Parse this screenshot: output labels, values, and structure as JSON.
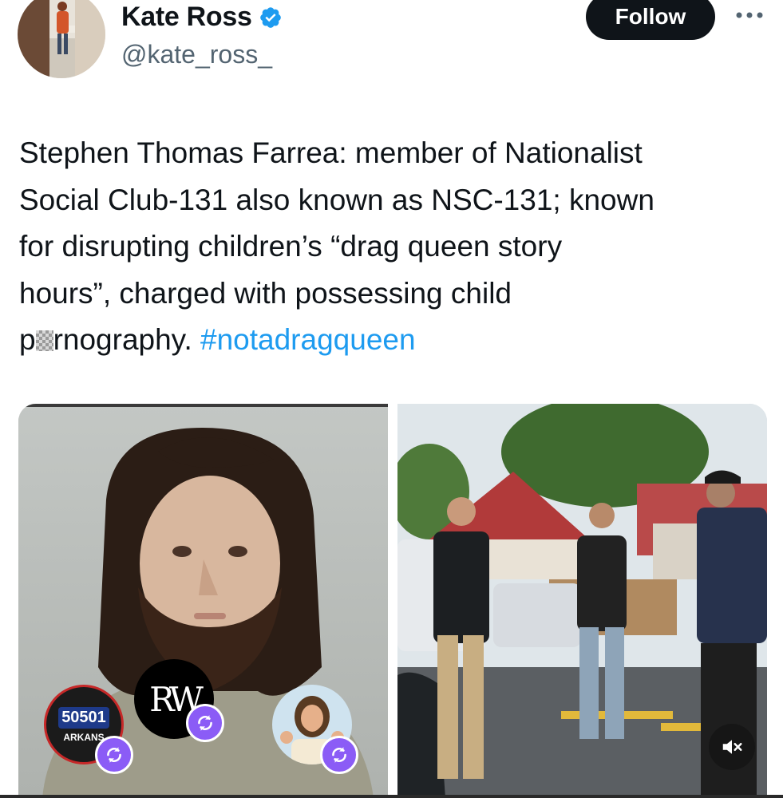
{
  "account": {
    "display_name": "Kate Ross",
    "handle": "@kate_ross_",
    "verified": true,
    "verified_color": "#1d9bf0"
  },
  "header": {
    "follow_label": "Follow",
    "more_icon": "more-dots-icon"
  },
  "tweet": {
    "text_line1": "Stephen Thomas Farrea: member of Nationalist",
    "text_line2": "Social Club-131 also known as NSC-131; known",
    "text_line3": "for disrupting children’s “drag queen story",
    "text_line4": "hours”, charged with possessing child",
    "text_word_prefix": "p",
    "text_word_suffix": "rnography.",
    "hashtag": "#notadragqueen",
    "hashtag_color": "#1d9bf0"
  },
  "media": {
    "stickers": [
      {
        "name": "50501-arkansas-sticker",
        "text_top": "50501",
        "text_bottom": "ARKANS"
      },
      {
        "name": "rw-logo-sticker",
        "text": "RW"
      },
      {
        "name": "jesus-thumbs-up-sticker"
      }
    ],
    "sticker_badge_color": "#8b5cf6",
    "video_control": "mute-icon"
  }
}
